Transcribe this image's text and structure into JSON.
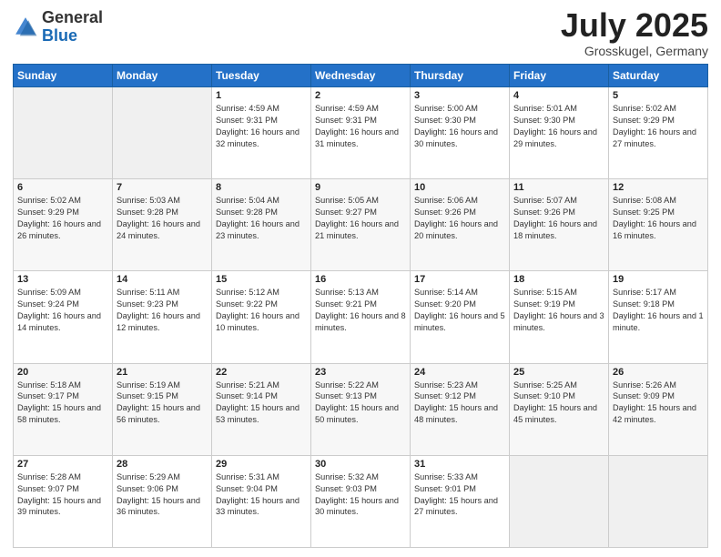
{
  "header": {
    "logo_general": "General",
    "logo_blue": "Blue",
    "month_year": "July 2025",
    "location": "Grosskugel, Germany"
  },
  "days_of_week": [
    "Sunday",
    "Monday",
    "Tuesday",
    "Wednesday",
    "Thursday",
    "Friday",
    "Saturday"
  ],
  "weeks": [
    [
      {
        "day": "",
        "info": ""
      },
      {
        "day": "",
        "info": ""
      },
      {
        "day": "1",
        "info": "Sunrise: 4:59 AM\nSunset: 9:31 PM\nDaylight: 16 hours\nand 32 minutes."
      },
      {
        "day": "2",
        "info": "Sunrise: 4:59 AM\nSunset: 9:31 PM\nDaylight: 16 hours\nand 31 minutes."
      },
      {
        "day": "3",
        "info": "Sunrise: 5:00 AM\nSunset: 9:30 PM\nDaylight: 16 hours\nand 30 minutes."
      },
      {
        "day": "4",
        "info": "Sunrise: 5:01 AM\nSunset: 9:30 PM\nDaylight: 16 hours\nand 29 minutes."
      },
      {
        "day": "5",
        "info": "Sunrise: 5:02 AM\nSunset: 9:29 PM\nDaylight: 16 hours\nand 27 minutes."
      }
    ],
    [
      {
        "day": "6",
        "info": "Sunrise: 5:02 AM\nSunset: 9:29 PM\nDaylight: 16 hours\nand 26 minutes."
      },
      {
        "day": "7",
        "info": "Sunrise: 5:03 AM\nSunset: 9:28 PM\nDaylight: 16 hours\nand 24 minutes."
      },
      {
        "day": "8",
        "info": "Sunrise: 5:04 AM\nSunset: 9:28 PM\nDaylight: 16 hours\nand 23 minutes."
      },
      {
        "day": "9",
        "info": "Sunrise: 5:05 AM\nSunset: 9:27 PM\nDaylight: 16 hours\nand 21 minutes."
      },
      {
        "day": "10",
        "info": "Sunrise: 5:06 AM\nSunset: 9:26 PM\nDaylight: 16 hours\nand 20 minutes."
      },
      {
        "day": "11",
        "info": "Sunrise: 5:07 AM\nSunset: 9:26 PM\nDaylight: 16 hours\nand 18 minutes."
      },
      {
        "day": "12",
        "info": "Sunrise: 5:08 AM\nSunset: 9:25 PM\nDaylight: 16 hours\nand 16 minutes."
      }
    ],
    [
      {
        "day": "13",
        "info": "Sunrise: 5:09 AM\nSunset: 9:24 PM\nDaylight: 16 hours\nand 14 minutes."
      },
      {
        "day": "14",
        "info": "Sunrise: 5:11 AM\nSunset: 9:23 PM\nDaylight: 16 hours\nand 12 minutes."
      },
      {
        "day": "15",
        "info": "Sunrise: 5:12 AM\nSunset: 9:22 PM\nDaylight: 16 hours\nand 10 minutes."
      },
      {
        "day": "16",
        "info": "Sunrise: 5:13 AM\nSunset: 9:21 PM\nDaylight: 16 hours\nand 8 minutes."
      },
      {
        "day": "17",
        "info": "Sunrise: 5:14 AM\nSunset: 9:20 PM\nDaylight: 16 hours\nand 5 minutes."
      },
      {
        "day": "18",
        "info": "Sunrise: 5:15 AM\nSunset: 9:19 PM\nDaylight: 16 hours\nand 3 minutes."
      },
      {
        "day": "19",
        "info": "Sunrise: 5:17 AM\nSunset: 9:18 PM\nDaylight: 16 hours\nand 1 minute."
      }
    ],
    [
      {
        "day": "20",
        "info": "Sunrise: 5:18 AM\nSunset: 9:17 PM\nDaylight: 15 hours\nand 58 minutes."
      },
      {
        "day": "21",
        "info": "Sunrise: 5:19 AM\nSunset: 9:15 PM\nDaylight: 15 hours\nand 56 minutes."
      },
      {
        "day": "22",
        "info": "Sunrise: 5:21 AM\nSunset: 9:14 PM\nDaylight: 15 hours\nand 53 minutes."
      },
      {
        "day": "23",
        "info": "Sunrise: 5:22 AM\nSunset: 9:13 PM\nDaylight: 15 hours\nand 50 minutes."
      },
      {
        "day": "24",
        "info": "Sunrise: 5:23 AM\nSunset: 9:12 PM\nDaylight: 15 hours\nand 48 minutes."
      },
      {
        "day": "25",
        "info": "Sunrise: 5:25 AM\nSunset: 9:10 PM\nDaylight: 15 hours\nand 45 minutes."
      },
      {
        "day": "26",
        "info": "Sunrise: 5:26 AM\nSunset: 9:09 PM\nDaylight: 15 hours\nand 42 minutes."
      }
    ],
    [
      {
        "day": "27",
        "info": "Sunrise: 5:28 AM\nSunset: 9:07 PM\nDaylight: 15 hours\nand 39 minutes."
      },
      {
        "day": "28",
        "info": "Sunrise: 5:29 AM\nSunset: 9:06 PM\nDaylight: 15 hours\nand 36 minutes."
      },
      {
        "day": "29",
        "info": "Sunrise: 5:31 AM\nSunset: 9:04 PM\nDaylight: 15 hours\nand 33 minutes."
      },
      {
        "day": "30",
        "info": "Sunrise: 5:32 AM\nSunset: 9:03 PM\nDaylight: 15 hours\nand 30 minutes."
      },
      {
        "day": "31",
        "info": "Sunrise: 5:33 AM\nSunset: 9:01 PM\nDaylight: 15 hours\nand 27 minutes."
      },
      {
        "day": "",
        "info": ""
      },
      {
        "day": "",
        "info": ""
      }
    ]
  ]
}
